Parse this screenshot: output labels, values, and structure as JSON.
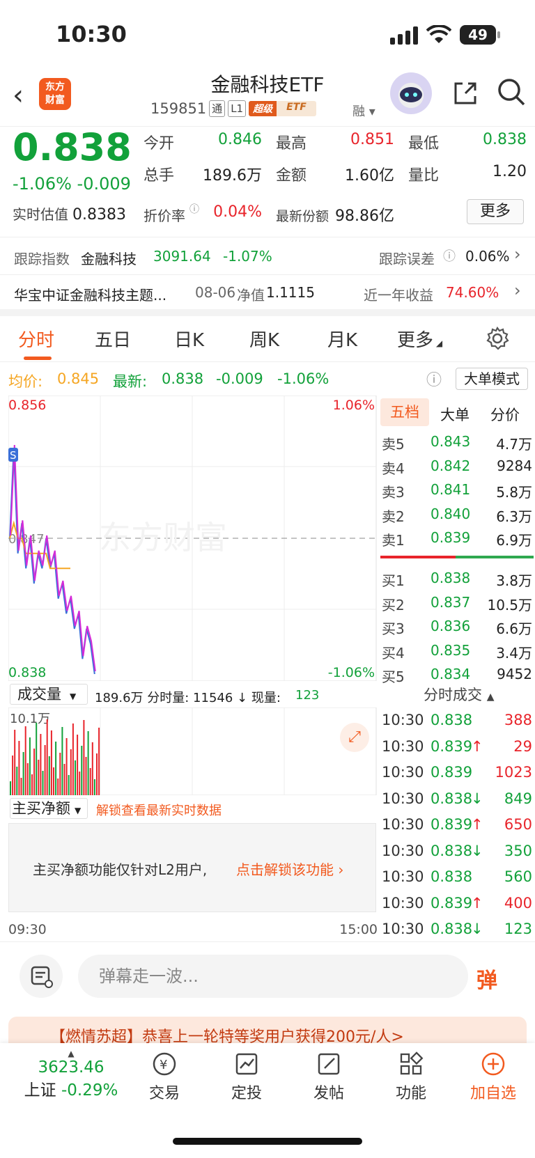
{
  "status": {
    "time": "10:30",
    "battery": "49"
  },
  "header": {
    "back": "‹",
    "logo": "东方\n财富",
    "title": "金融科技ETF",
    "code": "159851",
    "tag_tong": "通",
    "tag_l1": "L1",
    "tag_super": "超级",
    "tag_etf": "ETF",
    "tag_rong": "融"
  },
  "quote": {
    "price": "0.838",
    "change": "-1.06%  -0.009",
    "estimate_label": "实时估值",
    "estimate_value": "0.8383",
    "open_label": "今开",
    "open_value": "0.846",
    "high_label": "最高",
    "high_value": "0.851",
    "low_label": "最低",
    "low_value": "0.838",
    "volume_label": "总手",
    "volume_value": "189.6万",
    "amount_label": "金额",
    "amount_value": "1.60亿",
    "ratio_label": "量比",
    "ratio_value": "1.20",
    "premium_label": "折价率",
    "premium_value": "0.04%",
    "shares_label": "最新份额",
    "shares_value": "98.86亿",
    "more_button": "更多"
  },
  "tracking": {
    "label": "跟踪指数",
    "index_name": "金融科技",
    "index_value": "3091.64",
    "index_change": "-1.07%",
    "error_label": "跟踪误差",
    "error_value": "0.06%"
  },
  "fund": {
    "name": "华宝中证金融科技主题...",
    "nav_date": "08-06",
    "nav_label": "净值",
    "nav_value": "1.1115",
    "year_label": "近一年收益",
    "year_value": "74.60%"
  },
  "tabs": [
    "分时",
    "五日",
    "日K",
    "周K",
    "月K",
    "更多"
  ],
  "avgline": {
    "avg_label": "均价:",
    "avg_value": "0.845",
    "latest_label": "最新:",
    "latest_value": "0.838",
    "latest_change": "-0.009",
    "latest_pct": "-1.06%",
    "mode_button": "大单模式"
  },
  "chart": {
    "y_top": "0.856",
    "y_bottom": "0.838",
    "y_mid": "0.847",
    "pct_top": "1.06%",
    "pct_bottom": "-1.06%",
    "marker": "S",
    "watermark": "东方财富",
    "volume_select": "成交量",
    "volume_text": "189.6万 分时量: 11546 ↓ 现量:",
    "volume_now": "123",
    "volume_max": "10.1万",
    "net_select": "主买净额",
    "net_unlock": "解锁查看最新实时数据",
    "l2_text": "主买净额功能仅针对L2用户,",
    "l2_link": "点击解锁该功能",
    "time_start": "09:30",
    "time_end": "15:00"
  },
  "chart_data": {
    "type": "line",
    "ylim": [
      0.838,
      0.856
    ],
    "series": [
      {
        "values": [
          0.847,
          0.853,
          0.846,
          0.848,
          0.845,
          0.847,
          0.844,
          0.846,
          0.845,
          0.847,
          0.845,
          0.846,
          0.843,
          0.844,
          0.842,
          0.843,
          0.841,
          0.842,
          0.839,
          0.841,
          0.84,
          0.838
        ]
      },
      {
        "values": [
          0.847,
          0.848,
          0.847,
          0.847,
          0.846,
          0.846,
          0.846,
          0.846,
          0.846,
          0.846,
          0.845,
          0.845,
          0.845,
          0.845,
          0.845,
          0.845
        ]
      }
    ]
  },
  "orderbook": {
    "tabs": [
      "五档",
      "大单",
      "分价"
    ],
    "asks": [
      {
        "label": "卖5",
        "price": "0.843",
        "vol": "4.7万"
      },
      {
        "label": "卖4",
        "price": "0.842",
        "vol": "9284"
      },
      {
        "label": "卖3",
        "price": "0.841",
        "vol": "5.8万"
      },
      {
        "label": "卖2",
        "price": "0.840",
        "vol": "6.3万"
      },
      {
        "label": "卖1",
        "price": "0.839",
        "vol": "6.9万"
      }
    ],
    "bids": [
      {
        "label": "买1",
        "price": "0.838",
        "vol": "3.8万"
      },
      {
        "label": "买2",
        "price": "0.837",
        "vol": "10.5万"
      },
      {
        "label": "买3",
        "price": "0.836",
        "vol": "6.6万"
      },
      {
        "label": "买4",
        "price": "0.835",
        "vol": "3.4万"
      },
      {
        "label": "买5",
        "price": "0.834",
        "vol": "9452"
      }
    ]
  },
  "trades": {
    "title": "分时成交",
    "rows": [
      {
        "time": "10:30",
        "price": "0.838",
        "arrow": "",
        "vol": "388",
        "color": "#e8242b"
      },
      {
        "time": "10:30",
        "price": "0.839",
        "arrow": "↑",
        "vol": "29",
        "color": "#e8242b"
      },
      {
        "time": "10:30",
        "price": "0.839",
        "arrow": "",
        "vol": "1023",
        "color": "#e8242b"
      },
      {
        "time": "10:30",
        "price": "0.838",
        "arrow": "↓",
        "vol": "849",
        "color": "#12a13a"
      },
      {
        "time": "10:30",
        "price": "0.839",
        "arrow": "↑",
        "vol": "650",
        "color": "#e8242b"
      },
      {
        "time": "10:30",
        "price": "0.838",
        "arrow": "↓",
        "vol": "350",
        "color": "#12a13a"
      },
      {
        "time": "10:30",
        "price": "0.838",
        "arrow": "",
        "vol": "560",
        "color": "#12a13a"
      },
      {
        "time": "10:30",
        "price": "0.839",
        "arrow": "↑",
        "vol": "400",
        "color": "#e8242b"
      },
      {
        "time": "10:30",
        "price": "0.838",
        "arrow": "↓",
        "vol": "123",
        "color": "#12a13a"
      }
    ]
  },
  "danmu": {
    "placeholder": "弹幕走一波...",
    "button": "弹"
  },
  "banner": {
    "text": "【燃情苏超】恭喜上一轮特等奖用户获得200元/人>"
  },
  "nav": {
    "index_value": "3623.46",
    "index_name": "上证",
    "index_change": "-0.29%",
    "items": [
      "交易",
      "定投",
      "发帖",
      "功能",
      "加自选"
    ]
  },
  "colors": {
    "up": "#e8242b",
    "down": "#12a13a",
    "accent": "#f25a1f",
    "avg": "#f5a623",
    "price_line": "#3a6fd8"
  }
}
